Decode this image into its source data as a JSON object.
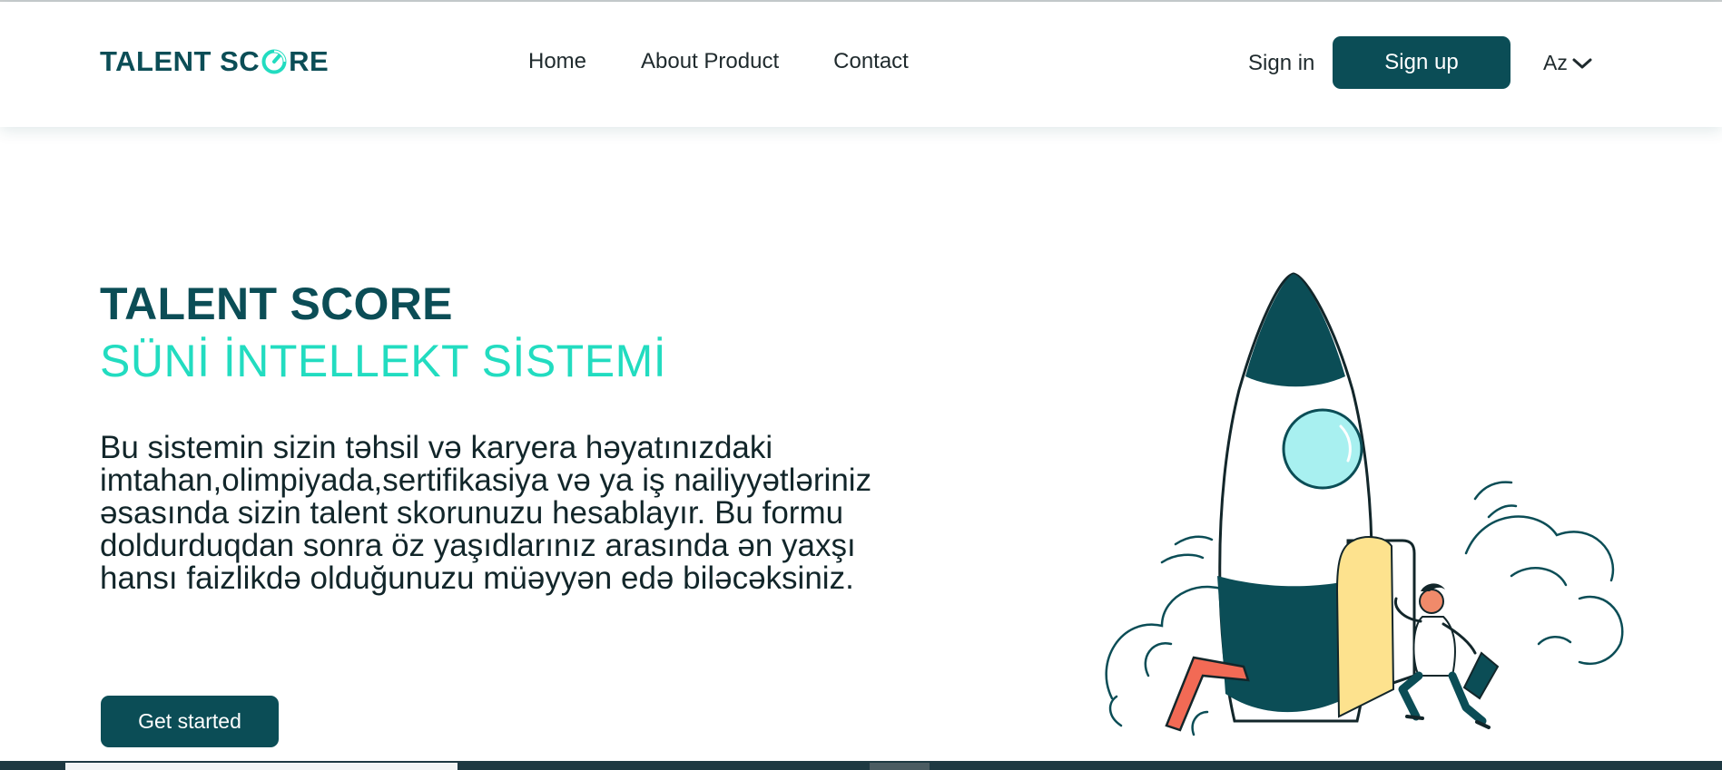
{
  "brand": {
    "logo_part1": "TALENT SC",
    "logo_part2": "RE",
    "primary_color": "#0b4d56",
    "accent_color": "#22dcc0"
  },
  "nav": {
    "items": [
      {
        "label": "Home"
      },
      {
        "label": "About Product"
      },
      {
        "label": "Contact"
      }
    ]
  },
  "auth": {
    "sign_in_label": "Sign in",
    "sign_up_label": "Sign up"
  },
  "language": {
    "selected": "Az",
    "icon": "chevron-down-icon"
  },
  "hero": {
    "title": "TALENT SCORE",
    "subtitle": "SÜNİ İNTELLEKT SİSTEMİ",
    "description": "Bu sistemin sizin təhsil və karyera həyatınızdaki imtahan,olimpiyada,sertifikasiya və ya iş nailiyyətləriniz əsasında sizin talent skorunuzu hesablayır. Bu formu doldurduqdan sonra öz yaşıdlarınız arasında ən yaxşı hansı faizlikdə olduğunuzu müəyyən edə biləcəksiniz.",
    "cta_label": "Get started"
  },
  "illustration": {
    "icon": "rocket-launch-illustration"
  }
}
